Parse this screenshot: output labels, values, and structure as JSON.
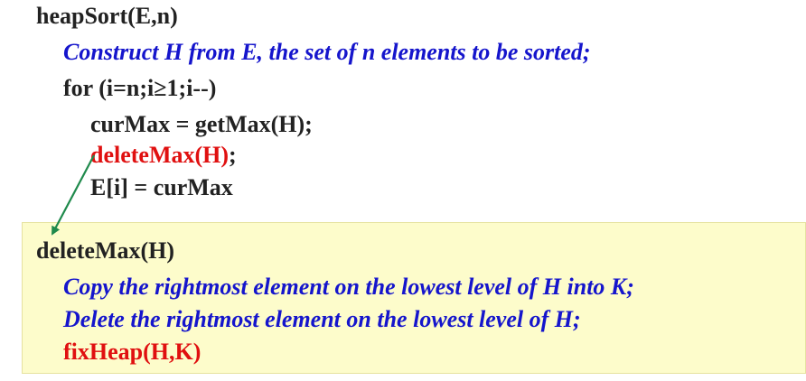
{
  "heapsort": {
    "signature": "heapSort(E,n)",
    "construct": "Construct H from E, the set of n elements to be sorted;",
    "for_loop": "for (i=n;i≥1;i--)",
    "cur_max": "curMax = getMax(H);",
    "delete_max_call": "deleteMax(H)",
    "delete_max_semicolon": ";",
    "assign": "E[i] = curMax"
  },
  "delete_max": {
    "signature": "deleteMax(H)",
    "copy_line": "Copy the rightmost element on the lowest level of H into K;",
    "delete_line": "Delete the rightmost element on the lowest level of H;",
    "fix_heap": "fixHeap(H,K)"
  },
  "colors": {
    "code_text": "#222222",
    "comment_text": "#1515cc",
    "highlight_text": "#e01010",
    "box_fill": "#fdfccb",
    "arrow": "#1f8a4c"
  }
}
